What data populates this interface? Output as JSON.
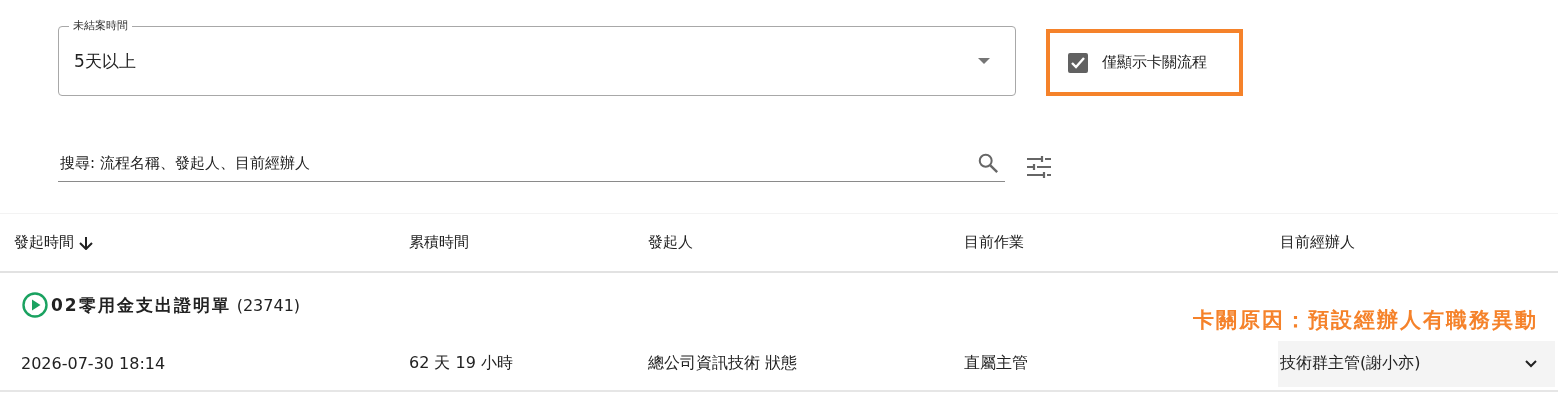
{
  "filters": {
    "duration_select": {
      "label": "未結案時間",
      "value": "5天以上"
    },
    "stuck_only": {
      "label": "僅顯示卡關流程",
      "checked": true,
      "highlighted": true
    }
  },
  "search": {
    "placeholder": "搜尋: 流程名稱、發起人、目前經辦人"
  },
  "table": {
    "columns": [
      {
        "label": "發起時間",
        "sorted": true
      },
      {
        "label": "累積時間",
        "sorted": false
      },
      {
        "label": "發起人",
        "sorted": false
      },
      {
        "label": "目前作業",
        "sorted": false
      },
      {
        "label": "目前經辦人",
        "sorted": false
      }
    ],
    "groups": [
      {
        "title": "02零用金支出證明單",
        "number": "(23741)",
        "note": "卡關原因：預設經辦人有職務異動",
        "rows": [
          {
            "cells": [
              "2026-07-30 18:14",
              "62 天 19 小時",
              "總公司資訊技術 狀態",
              "直屬主管"
            ],
            "assignee": "技術群主管(謝小亦)"
          }
        ]
      }
    ]
  }
}
